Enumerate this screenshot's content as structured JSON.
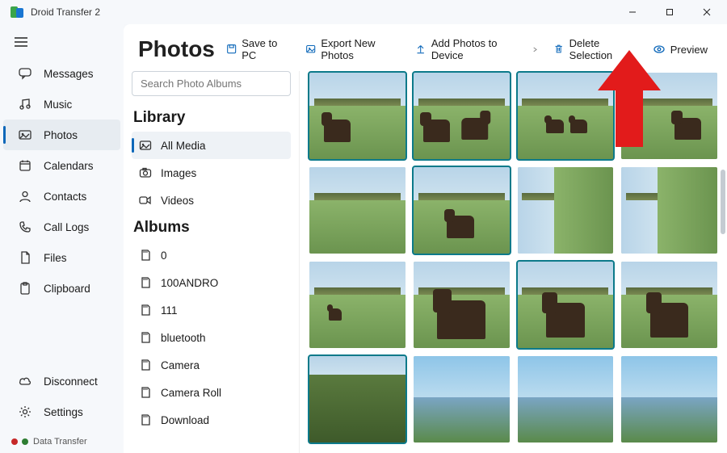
{
  "window": {
    "title": "Droid Transfer 2"
  },
  "nav": {
    "items": [
      {
        "label": "Messages",
        "icon": "chat-icon"
      },
      {
        "label": "Music",
        "icon": "music-icon"
      },
      {
        "label": "Photos",
        "icon": "photo-icon",
        "active": true
      },
      {
        "label": "Calendars",
        "icon": "calendar-icon"
      },
      {
        "label": "Contacts",
        "icon": "contact-icon"
      },
      {
        "label": "Call Logs",
        "icon": "phone-icon"
      },
      {
        "label": "Files",
        "icon": "file-icon"
      },
      {
        "label": "Clipboard",
        "icon": "clipboard-icon"
      }
    ],
    "bottom": [
      {
        "label": "Disconnect",
        "icon": "cloud-icon"
      },
      {
        "label": "Settings",
        "icon": "gear-icon"
      }
    ],
    "status": "Data Transfer"
  },
  "page": {
    "title": "Photos"
  },
  "toolbar": {
    "save_label": "Save to PC",
    "export_label": "Export New Photos",
    "add_label": "Add Photos to Device",
    "delete_label": "Delete Selection",
    "preview_label": "Preview"
  },
  "search": {
    "placeholder": "Search Photo Albums"
  },
  "library": {
    "header": "Library",
    "items": [
      {
        "label": "All Media",
        "icon": "gallery-icon",
        "active": true
      },
      {
        "label": "Images",
        "icon": "camera-icon"
      },
      {
        "label": "Videos",
        "icon": "video-icon"
      }
    ]
  },
  "albums": {
    "header": "Albums",
    "items": [
      {
        "label": "0"
      },
      {
        "label": "100ANDRO"
      },
      {
        "label": "111"
      },
      {
        "label": "bluetooth"
      },
      {
        "label": "Camera"
      },
      {
        "label": "Camera Roll"
      },
      {
        "label": "Download"
      }
    ]
  },
  "photos": {
    "thumbnails": [
      {
        "selected": true,
        "variant": "horse-left"
      },
      {
        "selected": true,
        "variant": "horse-two"
      },
      {
        "selected": true,
        "variant": "horse-far"
      },
      {
        "selected": false,
        "variant": "horse-right"
      },
      {
        "selected": false,
        "variant": "field"
      },
      {
        "selected": true,
        "variant": "horse-graze"
      },
      {
        "selected": false,
        "variant": "rotated"
      },
      {
        "selected": false,
        "variant": "rotated"
      },
      {
        "selected": false,
        "variant": "horse-far2"
      },
      {
        "selected": false,
        "variant": "horse-close"
      },
      {
        "selected": true,
        "variant": "horse-face"
      },
      {
        "selected": false,
        "variant": "horse-face2"
      },
      {
        "selected": true,
        "variant": "bushes"
      },
      {
        "selected": false,
        "variant": "lake"
      },
      {
        "selected": false,
        "variant": "lake2"
      },
      {
        "selected": false,
        "variant": "lake3"
      }
    ]
  },
  "annotation": {
    "points_to": "Delete Selection",
    "color": "#e21b1b"
  }
}
